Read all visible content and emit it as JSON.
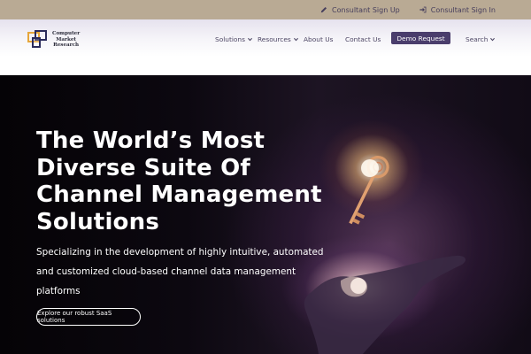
{
  "topbar": {
    "consultant_signup": "Consultant Sign Up",
    "consultant_signup_icon": "pencil-icon",
    "consultant_signin": "Consultant Sign In",
    "consultant_signin_icon": "sign-in-icon"
  },
  "logo": {
    "line1": "Computer",
    "line2": "Market",
    "line3": "Research"
  },
  "nav": {
    "items": [
      {
        "label": "Solutions",
        "has_dropdown": true
      },
      {
        "label": "Resources",
        "has_dropdown": true
      },
      {
        "label": "About Us",
        "has_dropdown": false
      },
      {
        "label": "Contact Us",
        "has_dropdown": false
      }
    ],
    "demo_request": "Demo Request",
    "search": "Search"
  },
  "hero": {
    "title": "The World’s Most Diverse Suite Of Channel Management Solutions",
    "subtitle": "Specializing in the development of highly intuitive, automated and customized cloud-based channel data management platforms",
    "cta": "Explore our robust SaaS solutions"
  },
  "colors": {
    "topbar_bg": "#b9aa94",
    "brand_purple": "#4a3d6c",
    "nav_text": "#4d4664",
    "logo_orange": "#e6a63a",
    "logo_navy": "#2a2a5a"
  }
}
